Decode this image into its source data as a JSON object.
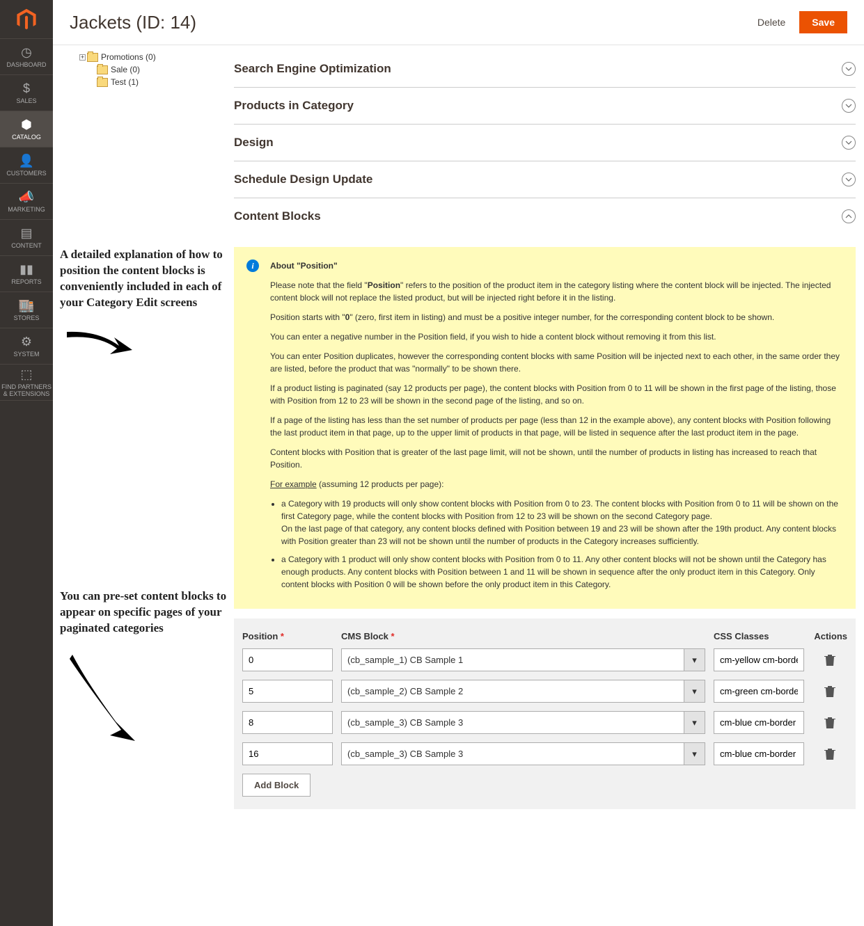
{
  "sidebar": {
    "items": [
      {
        "label": "DASHBOARD",
        "icon": "gauge"
      },
      {
        "label": "SALES",
        "icon": "dollar"
      },
      {
        "label": "CATALOG",
        "icon": "cube",
        "active": true
      },
      {
        "label": "CUSTOMERS",
        "icon": "person"
      },
      {
        "label": "MARKETING",
        "icon": "megaphone"
      },
      {
        "label": "CONTENT",
        "icon": "layout"
      },
      {
        "label": "REPORTS",
        "icon": "bars"
      },
      {
        "label": "STORES",
        "icon": "storefront"
      },
      {
        "label": "SYSTEM",
        "icon": "gear"
      },
      {
        "label": "FIND PARTNERS & EXTENSIONS",
        "icon": "boxes"
      }
    ]
  },
  "header": {
    "title": "Jackets (ID: 14)",
    "delete": "Delete",
    "save": "Save"
  },
  "tree": {
    "items": [
      {
        "label": "Promotions (0)",
        "indent": 0,
        "expandable": true
      },
      {
        "label": "Sale (0)",
        "indent": 1,
        "expandable": false
      },
      {
        "label": "Test (1)",
        "indent": 1,
        "expandable": false
      }
    ]
  },
  "sections": [
    {
      "label": "Search Engine Optimization",
      "open": false
    },
    {
      "label": "Products in Category",
      "open": false
    },
    {
      "label": "Design",
      "open": false
    },
    {
      "label": "Schedule Design Update",
      "open": false
    },
    {
      "label": "Content Blocks",
      "open": true
    }
  ],
  "annotations": {
    "note1": "A detailed explanation of how to position the content blocks is conveniently included in each of your Category Edit screens",
    "note2": "You can pre-set content blocks to appear on specific pages of your paginated categories"
  },
  "info": {
    "title": "About \"Position\"",
    "p1_a": "Please note that the field \"",
    "p1_bold": "Position",
    "p1_b": "\" refers to the position of the product item in the category listing where the content block will be injected. The injected content block will not replace the listed product, but will be injected right before it in the listing.",
    "p2_a": "Position starts with \"",
    "p2_bold": "0",
    "p2_b": "\" (zero, first item in listing) and must be a positive integer number, for the corresponding content block to be shown.",
    "p3": "You can enter a negative number in the Position field, if you wish to hide a content block without removing it from this list.",
    "p4": "You can enter Position duplicates, however the corresponding content blocks with same Position will be injected next to each other, in the same order they are listed, before the product that was \"normally\" to be shown there.",
    "p5": "If a product listing is paginated (say 12 products per page), the content blocks with Position from 0 to 11 will be shown in the first page of the listing, those with Position from 12 to 23 will be shown in the second page of the listing, and so on.",
    "p6": "If a page of the listing has less than the set number of products per page (less than 12 in the example above), any content blocks with Position following the last product item in that page, up to the upper limit of products in that page, will be listed in sequence after the last product item in the page.",
    "p7": "Content blocks with Position that is greater of the last page limit, will not be shown, until the number of products in listing has increased to reach that Position.",
    "example_label": "For example",
    "example_trail": " (assuming 12 products per page):",
    "li1_a": "a Category with 19 products will only show content blocks with Position from 0 to 23. The content blocks with Position from 0 to 11 will be shown on the first Category page, while the content blocks with Position from 12 to 23 will be shown on the second Category page.",
    "li1_b": "On the last page of that category, any content blocks defined with Position between 19 and 23 will be shown after the 19th product. Any content blocks with Position greater than 23 will not be shown until the number of products in the Category increases sufficiently.",
    "li2": "a Category with 1 product will only show content blocks with Position from 0 to 11. Any other content blocks will not be shown until the Category has enough products. Any content blocks with Position between 1 and 11 will be shown in sequence after the only product item in this Category. Only content blocks with Position 0 will be shown before the only product item in this Category."
  },
  "grid": {
    "head": {
      "position": "Position",
      "cmsblock": "CMS Block",
      "css": "CSS Classes",
      "actions": "Actions"
    },
    "rows": [
      {
        "position": "0",
        "block": "(cb_sample_1) CB Sample 1",
        "css": "cm-yellow cm-border"
      },
      {
        "position": "5",
        "block": "(cb_sample_2) CB Sample 2",
        "css": "cm-green cm-border"
      },
      {
        "position": "8",
        "block": "(cb_sample_3) CB Sample 3",
        "css": "cm-blue cm-border"
      },
      {
        "position": "16",
        "block": "(cb_sample_3) CB Sample 3",
        "css": "cm-blue cm-border"
      }
    ],
    "add": "Add Block"
  }
}
